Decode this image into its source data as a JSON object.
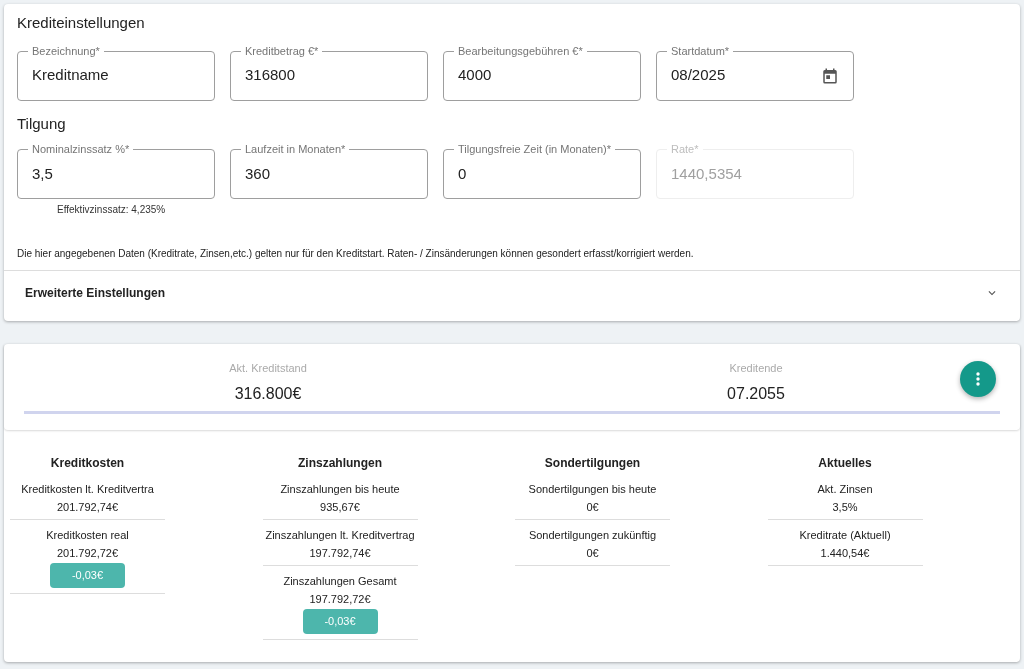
{
  "settings": {
    "title": "Krediteinstellungen",
    "fields": [
      {
        "label": "Bezeichnung*",
        "value": "Kreditname",
        "kind": "text",
        "disabled": false
      },
      {
        "label": "Kreditbetrag €*",
        "value": "316800",
        "kind": "text",
        "disabled": false
      },
      {
        "label": "Bearbeitungsgebühren €*",
        "value": "4000",
        "kind": "text",
        "disabled": false
      },
      {
        "label": "Startdatum*",
        "value": "08/2025",
        "kind": "date",
        "disabled": false
      }
    ],
    "tilgung_title": "Tilgung",
    "tilgung_fields": [
      {
        "label": "Nominalzinssatz %*",
        "value": "3,5",
        "disabled": false,
        "hint": "Effektivzinssatz: 4,235%"
      },
      {
        "label": "Laufzeit in Monaten*",
        "value": "360",
        "disabled": false
      },
      {
        "label": "Tilgungsfreie Zeit (in Monaten)*",
        "value": "0",
        "disabled": false
      },
      {
        "label": "Rate*",
        "value": "1440,5354",
        "disabled": true
      }
    ],
    "note": "Die hier angegebenen Daten (Kreditrate, Zinsen,etc.) gelten nur für den Kreditstart. Raten- / Zinsänderungen können gesondert erfasst/korrigiert werden.",
    "advanced": {
      "label": "Erweiterte Einstellungen",
      "expanded": false
    }
  },
  "summary": {
    "stats": [
      {
        "label": "Akt. Kreditstand",
        "value": "316.800€"
      },
      {
        "label": "Kreditende",
        "value": "07.2055"
      }
    ],
    "groups": [
      {
        "title": "Kreditkosten",
        "items": [
          {
            "label": "Kreditkosten lt. Kreditvertra",
            "value": "201.792,74€"
          },
          {
            "label": "Kreditkosten real",
            "value": "201.792,72€",
            "badge": "-0,03€"
          }
        ]
      },
      {
        "title": "Zinszahlungen",
        "items": [
          {
            "label": "Zinszahlungen bis heute",
            "value": "935,67€"
          },
          {
            "label": "Zinszahlungen lt. Kreditvertrag",
            "value": "197.792,74€"
          },
          {
            "label": "Zinszahlungen Gesamt",
            "value": "197.792,72€",
            "badge": "-0,03€"
          }
        ]
      },
      {
        "title": "Sondertilgungen",
        "items": [
          {
            "label": "Sondertilgungen bis heute",
            "value": "0€"
          },
          {
            "label": "Sondertilgungen zukünftig",
            "value": "0€"
          }
        ]
      },
      {
        "title": "Aktuelles",
        "items": [
          {
            "label": "Akt. Zinsen",
            "value": "3,5%"
          },
          {
            "label": "Kreditrate (Aktuell)",
            "value": "1.440,54€"
          }
        ]
      }
    ]
  }
}
